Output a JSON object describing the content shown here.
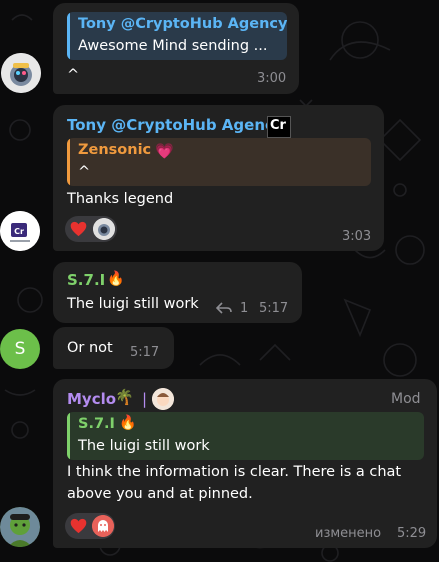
{
  "colors": {
    "bubble": "#212121",
    "accent_blue": "#5bb5f5",
    "accent_orange": "#f09a3e",
    "accent_green": "#7fd16b",
    "accent_purple": "#b48cf0",
    "time": "#8e8e93"
  },
  "messages": [
    {
      "id": "m1",
      "reply": {
        "title": "Tony @CryptoHub Agency",
        "text": "Awesome Mind sending ..."
      },
      "text": "^",
      "time": "3:00",
      "avatar": "astronaut-avatar"
    },
    {
      "id": "m2",
      "sender": "Tony @CryptoHub Agency",
      "sender_badge": "Cr",
      "reply": {
        "title": "Zensonic",
        "text": "^"
      },
      "text": "Thanks legend",
      "time": "3:03",
      "reactions": [
        "heart-icon",
        "astronaut-avatar"
      ],
      "avatar": "cryptohub-logo"
    },
    {
      "id": "m3",
      "sender": "S.7.I",
      "text": "The luigi still work",
      "reply_count": "1",
      "time": "5:17"
    },
    {
      "id": "m4",
      "text": "Or not",
      "time": "5:17",
      "avatar_letter": "S"
    },
    {
      "id": "m5",
      "sender": "Myclo",
      "separator": "|",
      "role": "Mod",
      "reply": {
        "title": "S.7.I",
        "text": "The luigi still work"
      },
      "text_lines": [
        "I think the information is clear. There is a chat",
        "above you and at pinned."
      ],
      "edited_label": "изменено",
      "time": "5:29",
      "reactions": [
        "heart-icon",
        "ghost-icon"
      ],
      "avatar": "hulk-avatar"
    }
  ]
}
